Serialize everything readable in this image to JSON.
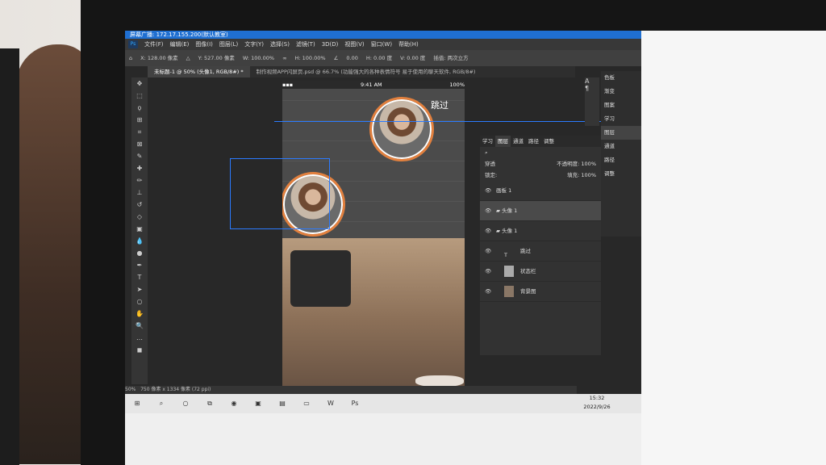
{
  "window": {
    "title": "屏幕广播: 172.17.155.200(默认教室)"
  },
  "menu": [
    "文件(F)",
    "编辑(E)",
    "图像(I)",
    "图层(L)",
    "文字(Y)",
    "选择(S)",
    "滤镜(T)",
    "3D(D)",
    "视图(V)",
    "窗口(W)",
    "帮助(H)"
  ],
  "ps_logo": "Ps",
  "options": {
    "x": "X: 128.00 像素",
    "y": "Y: 527.00 像素",
    "w": "W: 100.00%",
    "h": "H: 100.00%",
    "angle": "0.00",
    "hskew": "H: 0.00 度",
    "vskew": "V: 0.00 度",
    "interp": "插值: 两次立方"
  },
  "tabs": [
    "未标题-1 @ 50% (头像1, RGB/8#) *",
    "制作视频APP闪屏页.psd @ 66.7% (功能强大的各种表情符号 易于使用的聊天软件, RGB/8#)"
  ],
  "phone": {
    "time": "9:41 AM",
    "battery": "100%",
    "skip": "跳过"
  },
  "layers_panel": {
    "tabs": [
      "学习",
      "图层",
      "通道",
      "路径",
      "调整"
    ],
    "mode": "穿透",
    "opacity": "不透明度: 100%",
    "lock": "锁定:",
    "fill": "填充: 100%",
    "rows": [
      {
        "name": "画板 1"
      },
      {
        "name": "头像 1"
      },
      {
        "name": "头像 1"
      },
      {
        "name": "跳过"
      },
      {
        "name": "状态栏"
      },
      {
        "name": "背景图"
      }
    ]
  },
  "dock": [
    "色板",
    "渐变",
    "图案",
    "学习",
    "图层",
    "通道",
    "路径",
    "调整"
  ],
  "status": {
    "zoom": "50%",
    "doc": "750 像素 x 1334 像素 (72 ppi)"
  },
  "clock": {
    "time": "15:32",
    "date": "2022/9/26"
  }
}
